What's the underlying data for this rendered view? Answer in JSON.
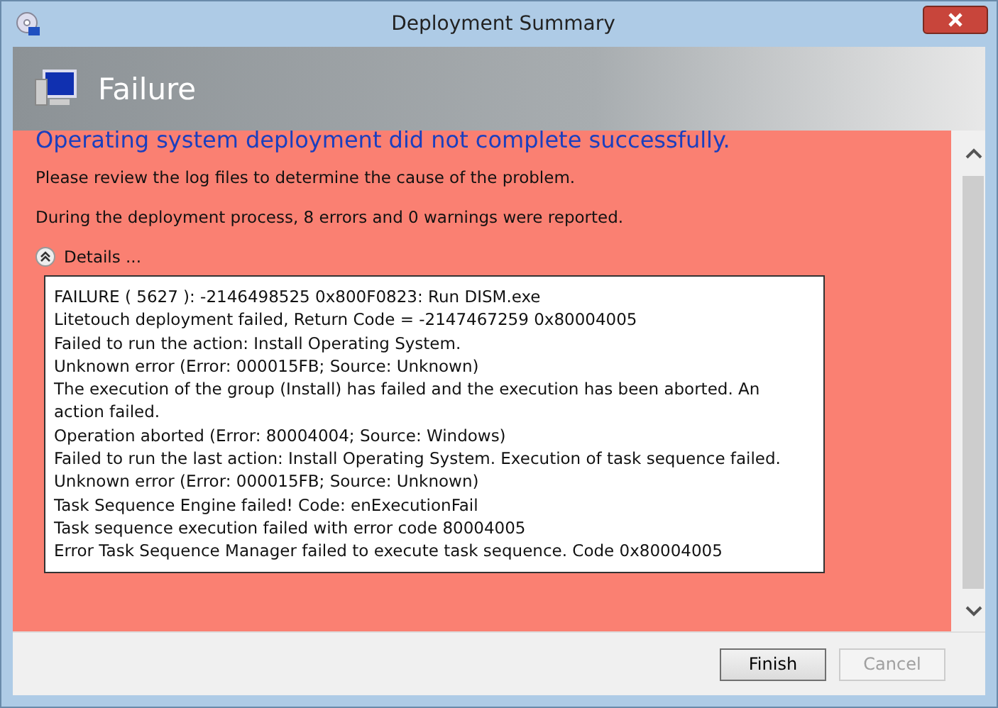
{
  "window": {
    "title": "Deployment Summary"
  },
  "header": {
    "title": "Failure"
  },
  "content": {
    "heading": "Operating system deployment did not complete successfully.",
    "paragraphs": [
      "Please review the log files to determine the cause of the problem.",
      "During the deployment process, 8 errors and 0 warnings were reported."
    ],
    "details": {
      "label": "Details ...",
      "expanded": true,
      "lines": [
        "FAILURE ( 5627 ): -2146498525  0x800F0823: Run DISM.exe",
        "Litetouch deployment failed, Return Code = -2147467259  0x80004005",
        "Failed to run the action: Install Operating System.",
        "Unknown error (Error: 000015FB; Source: Unknown)",
        "The execution of the group (Install) has failed and the execution has been aborted. An action failed.",
        "Operation aborted (Error: 80004004; Source: Windows)",
        "Failed to run the last action: Install Operating System. Execution of task sequence failed.",
        "Unknown error (Error: 000015FB; Source: Unknown)",
        "Task Sequence Engine failed! Code: enExecutionFail",
        "Task sequence execution failed with error code 80004005",
        "Error Task Sequence Manager failed to execute task sequence. Code 0x80004005"
      ]
    }
  },
  "buttons": [
    {
      "label": "Finish",
      "disabled": false
    },
    {
      "label": "Cancel",
      "disabled": true
    }
  ]
}
